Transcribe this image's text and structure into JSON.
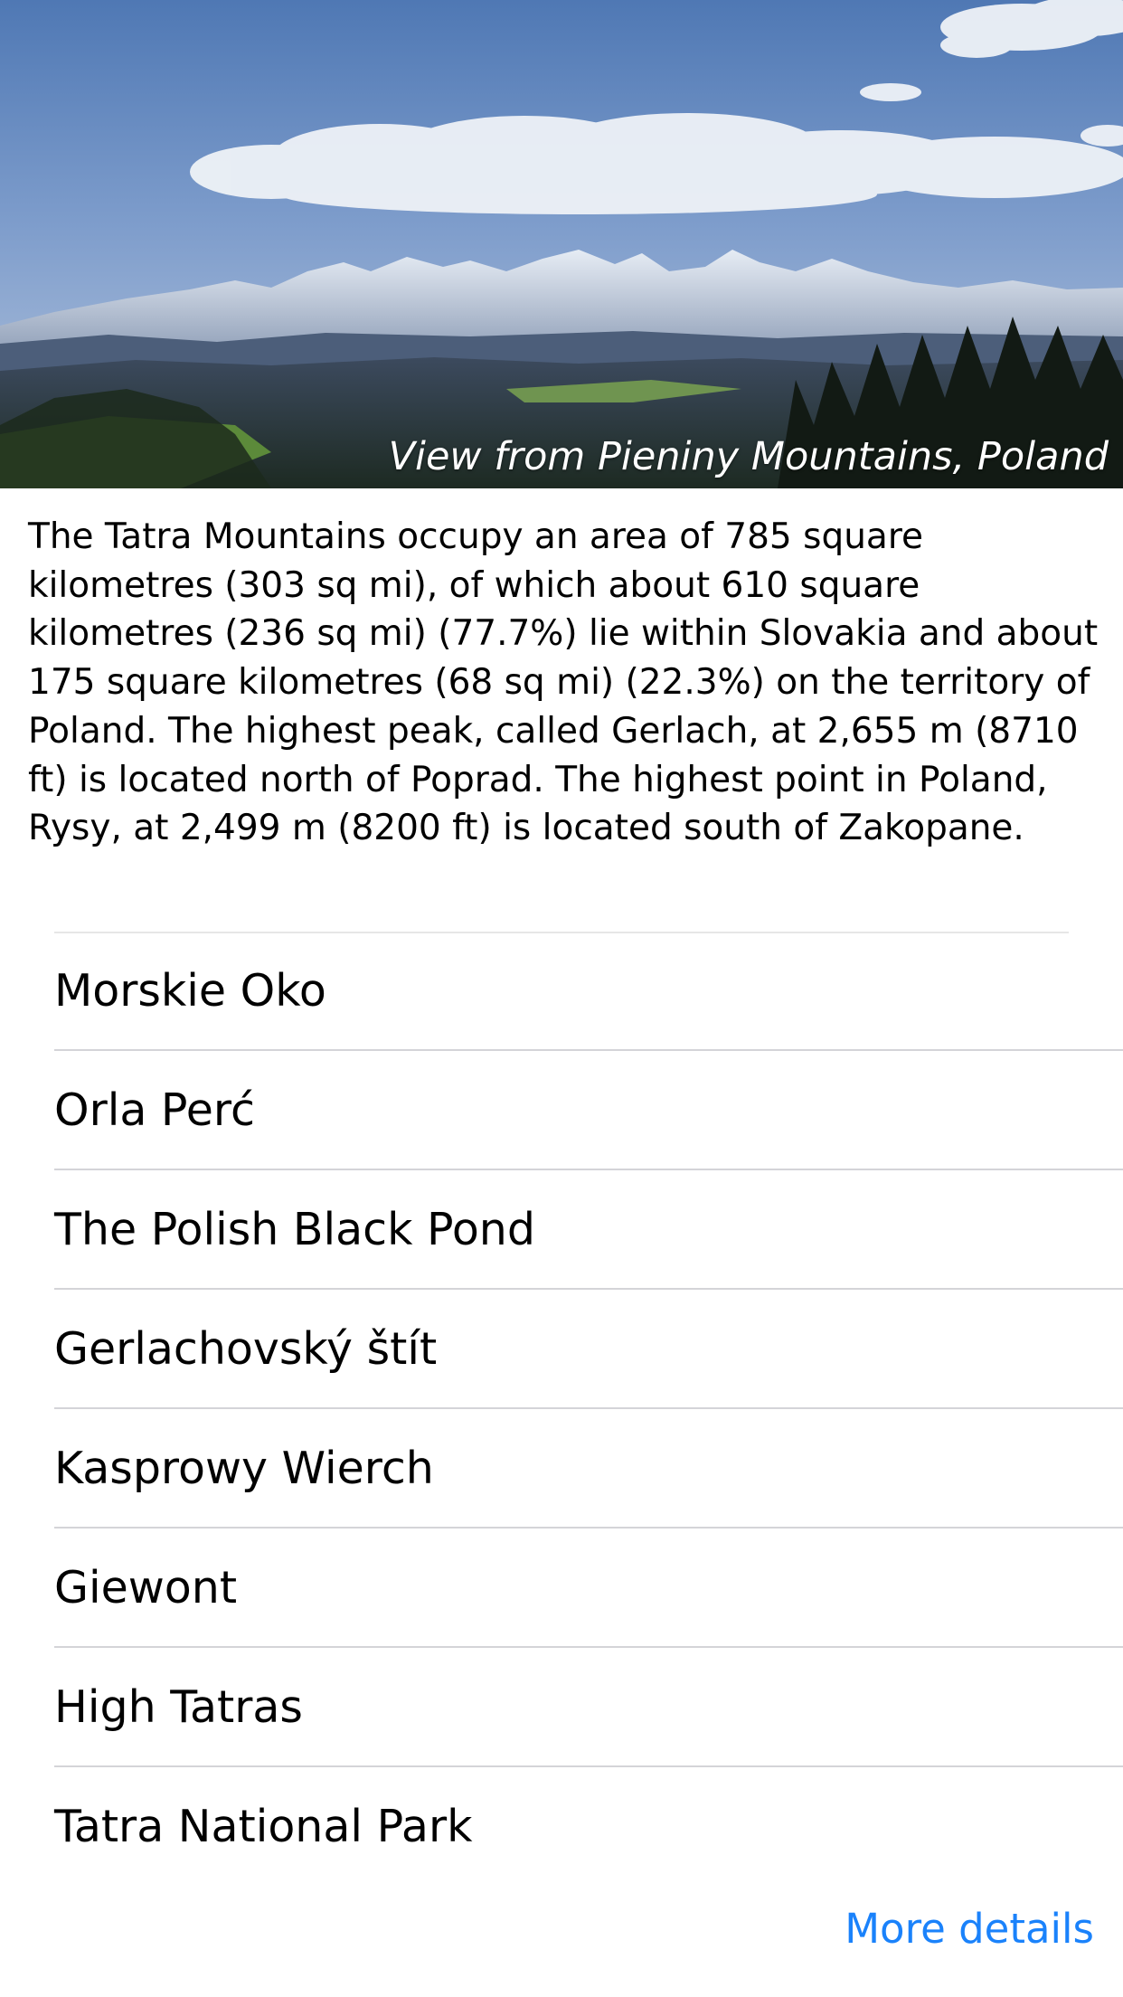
{
  "hero": {
    "caption": "View from Pieniny Mountains, Poland"
  },
  "description": "The Tatra Mountains occupy an area of 785 square kilometres (303 sq mi), of which about 610 square kilometres (236 sq mi) (77.7%) lie within Slovakia and about 175 square kilometres (68 sq mi) (22.3%) on the territory of Poland. The highest peak, called Gerlach, at 2,655 m (8710 ft) is located north of Poprad. The highest point in Poland, Rysy, at 2,499 m (8200 ft) is located south of Zakopane.",
  "list": {
    "items": [
      {
        "label": "Morskie Oko"
      },
      {
        "label": "Orla Perć"
      },
      {
        "label": "The Polish Black Pond"
      },
      {
        "label": "Gerlachovský štít"
      },
      {
        "label": "Kasprowy Wierch"
      },
      {
        "label": "Giewont"
      },
      {
        "label": "High Tatras"
      },
      {
        "label": "Tatra National Park"
      }
    ]
  },
  "footer": {
    "more_details_label": "More details"
  },
  "colors": {
    "link": "#1a82fb",
    "separator": "#d4d4d8"
  }
}
